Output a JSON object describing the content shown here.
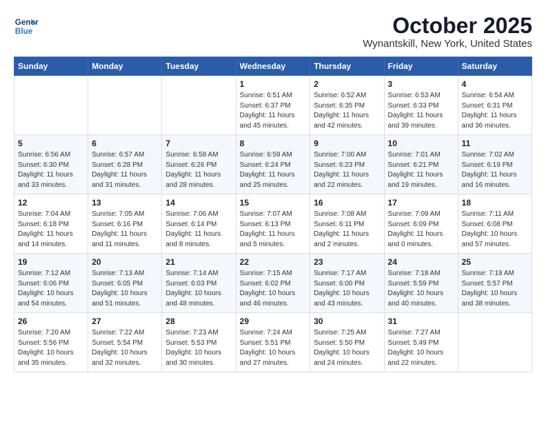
{
  "header": {
    "logo_line1": "General",
    "logo_line2": "Blue",
    "month": "October 2025",
    "location": "Wynantskill, New York, United States"
  },
  "days_of_week": [
    "Sunday",
    "Monday",
    "Tuesday",
    "Wednesday",
    "Thursday",
    "Friday",
    "Saturday"
  ],
  "weeks": [
    [
      {
        "day": "",
        "info": ""
      },
      {
        "day": "",
        "info": ""
      },
      {
        "day": "",
        "info": ""
      },
      {
        "day": "1",
        "info": "Sunrise: 6:51 AM\nSunset: 6:37 PM\nDaylight: 11 hours and 45 minutes."
      },
      {
        "day": "2",
        "info": "Sunrise: 6:52 AM\nSunset: 6:35 PM\nDaylight: 11 hours and 42 minutes."
      },
      {
        "day": "3",
        "info": "Sunrise: 6:53 AM\nSunset: 6:33 PM\nDaylight: 11 hours and 39 minutes."
      },
      {
        "day": "4",
        "info": "Sunrise: 6:54 AM\nSunset: 6:31 PM\nDaylight: 11 hours and 36 minutes."
      }
    ],
    [
      {
        "day": "5",
        "info": "Sunrise: 6:56 AM\nSunset: 6:30 PM\nDaylight: 11 hours and 33 minutes."
      },
      {
        "day": "6",
        "info": "Sunrise: 6:57 AM\nSunset: 6:28 PM\nDaylight: 11 hours and 31 minutes."
      },
      {
        "day": "7",
        "info": "Sunrise: 6:58 AM\nSunset: 6:26 PM\nDaylight: 11 hours and 28 minutes."
      },
      {
        "day": "8",
        "info": "Sunrise: 6:59 AM\nSunset: 6:24 PM\nDaylight: 11 hours and 25 minutes."
      },
      {
        "day": "9",
        "info": "Sunrise: 7:00 AM\nSunset: 6:23 PM\nDaylight: 11 hours and 22 minutes."
      },
      {
        "day": "10",
        "info": "Sunrise: 7:01 AM\nSunset: 6:21 PM\nDaylight: 11 hours and 19 minutes."
      },
      {
        "day": "11",
        "info": "Sunrise: 7:02 AM\nSunset: 6:19 PM\nDaylight: 11 hours and 16 minutes."
      }
    ],
    [
      {
        "day": "12",
        "info": "Sunrise: 7:04 AM\nSunset: 6:18 PM\nDaylight: 11 hours and 14 minutes."
      },
      {
        "day": "13",
        "info": "Sunrise: 7:05 AM\nSunset: 6:16 PM\nDaylight: 11 hours and 11 minutes."
      },
      {
        "day": "14",
        "info": "Sunrise: 7:06 AM\nSunset: 6:14 PM\nDaylight: 11 hours and 8 minutes."
      },
      {
        "day": "15",
        "info": "Sunrise: 7:07 AM\nSunset: 6:13 PM\nDaylight: 11 hours and 5 minutes."
      },
      {
        "day": "16",
        "info": "Sunrise: 7:08 AM\nSunset: 6:11 PM\nDaylight: 11 hours and 2 minutes."
      },
      {
        "day": "17",
        "info": "Sunrise: 7:09 AM\nSunset: 6:09 PM\nDaylight: 11 hours and 0 minutes."
      },
      {
        "day": "18",
        "info": "Sunrise: 7:11 AM\nSunset: 6:08 PM\nDaylight: 10 hours and 57 minutes."
      }
    ],
    [
      {
        "day": "19",
        "info": "Sunrise: 7:12 AM\nSunset: 6:06 PM\nDaylight: 10 hours and 54 minutes."
      },
      {
        "day": "20",
        "info": "Sunrise: 7:13 AM\nSunset: 6:05 PM\nDaylight: 10 hours and 51 minutes."
      },
      {
        "day": "21",
        "info": "Sunrise: 7:14 AM\nSunset: 6:03 PM\nDaylight: 10 hours and 48 minutes."
      },
      {
        "day": "22",
        "info": "Sunrise: 7:15 AM\nSunset: 6:02 PM\nDaylight: 10 hours and 46 minutes."
      },
      {
        "day": "23",
        "info": "Sunrise: 7:17 AM\nSunset: 6:00 PM\nDaylight: 10 hours and 43 minutes."
      },
      {
        "day": "24",
        "info": "Sunrise: 7:18 AM\nSunset: 5:59 PM\nDaylight: 10 hours and 40 minutes."
      },
      {
        "day": "25",
        "info": "Sunrise: 7:19 AM\nSunset: 5:57 PM\nDaylight: 10 hours and 38 minutes."
      }
    ],
    [
      {
        "day": "26",
        "info": "Sunrise: 7:20 AM\nSunset: 5:56 PM\nDaylight: 10 hours and 35 minutes."
      },
      {
        "day": "27",
        "info": "Sunrise: 7:22 AM\nSunset: 5:54 PM\nDaylight: 10 hours and 32 minutes."
      },
      {
        "day": "28",
        "info": "Sunrise: 7:23 AM\nSunset: 5:53 PM\nDaylight: 10 hours and 30 minutes."
      },
      {
        "day": "29",
        "info": "Sunrise: 7:24 AM\nSunset: 5:51 PM\nDaylight: 10 hours and 27 minutes."
      },
      {
        "day": "30",
        "info": "Sunrise: 7:25 AM\nSunset: 5:50 PM\nDaylight: 10 hours and 24 minutes."
      },
      {
        "day": "31",
        "info": "Sunrise: 7:27 AM\nSunset: 5:49 PM\nDaylight: 10 hours and 22 minutes."
      },
      {
        "day": "",
        "info": ""
      }
    ]
  ]
}
